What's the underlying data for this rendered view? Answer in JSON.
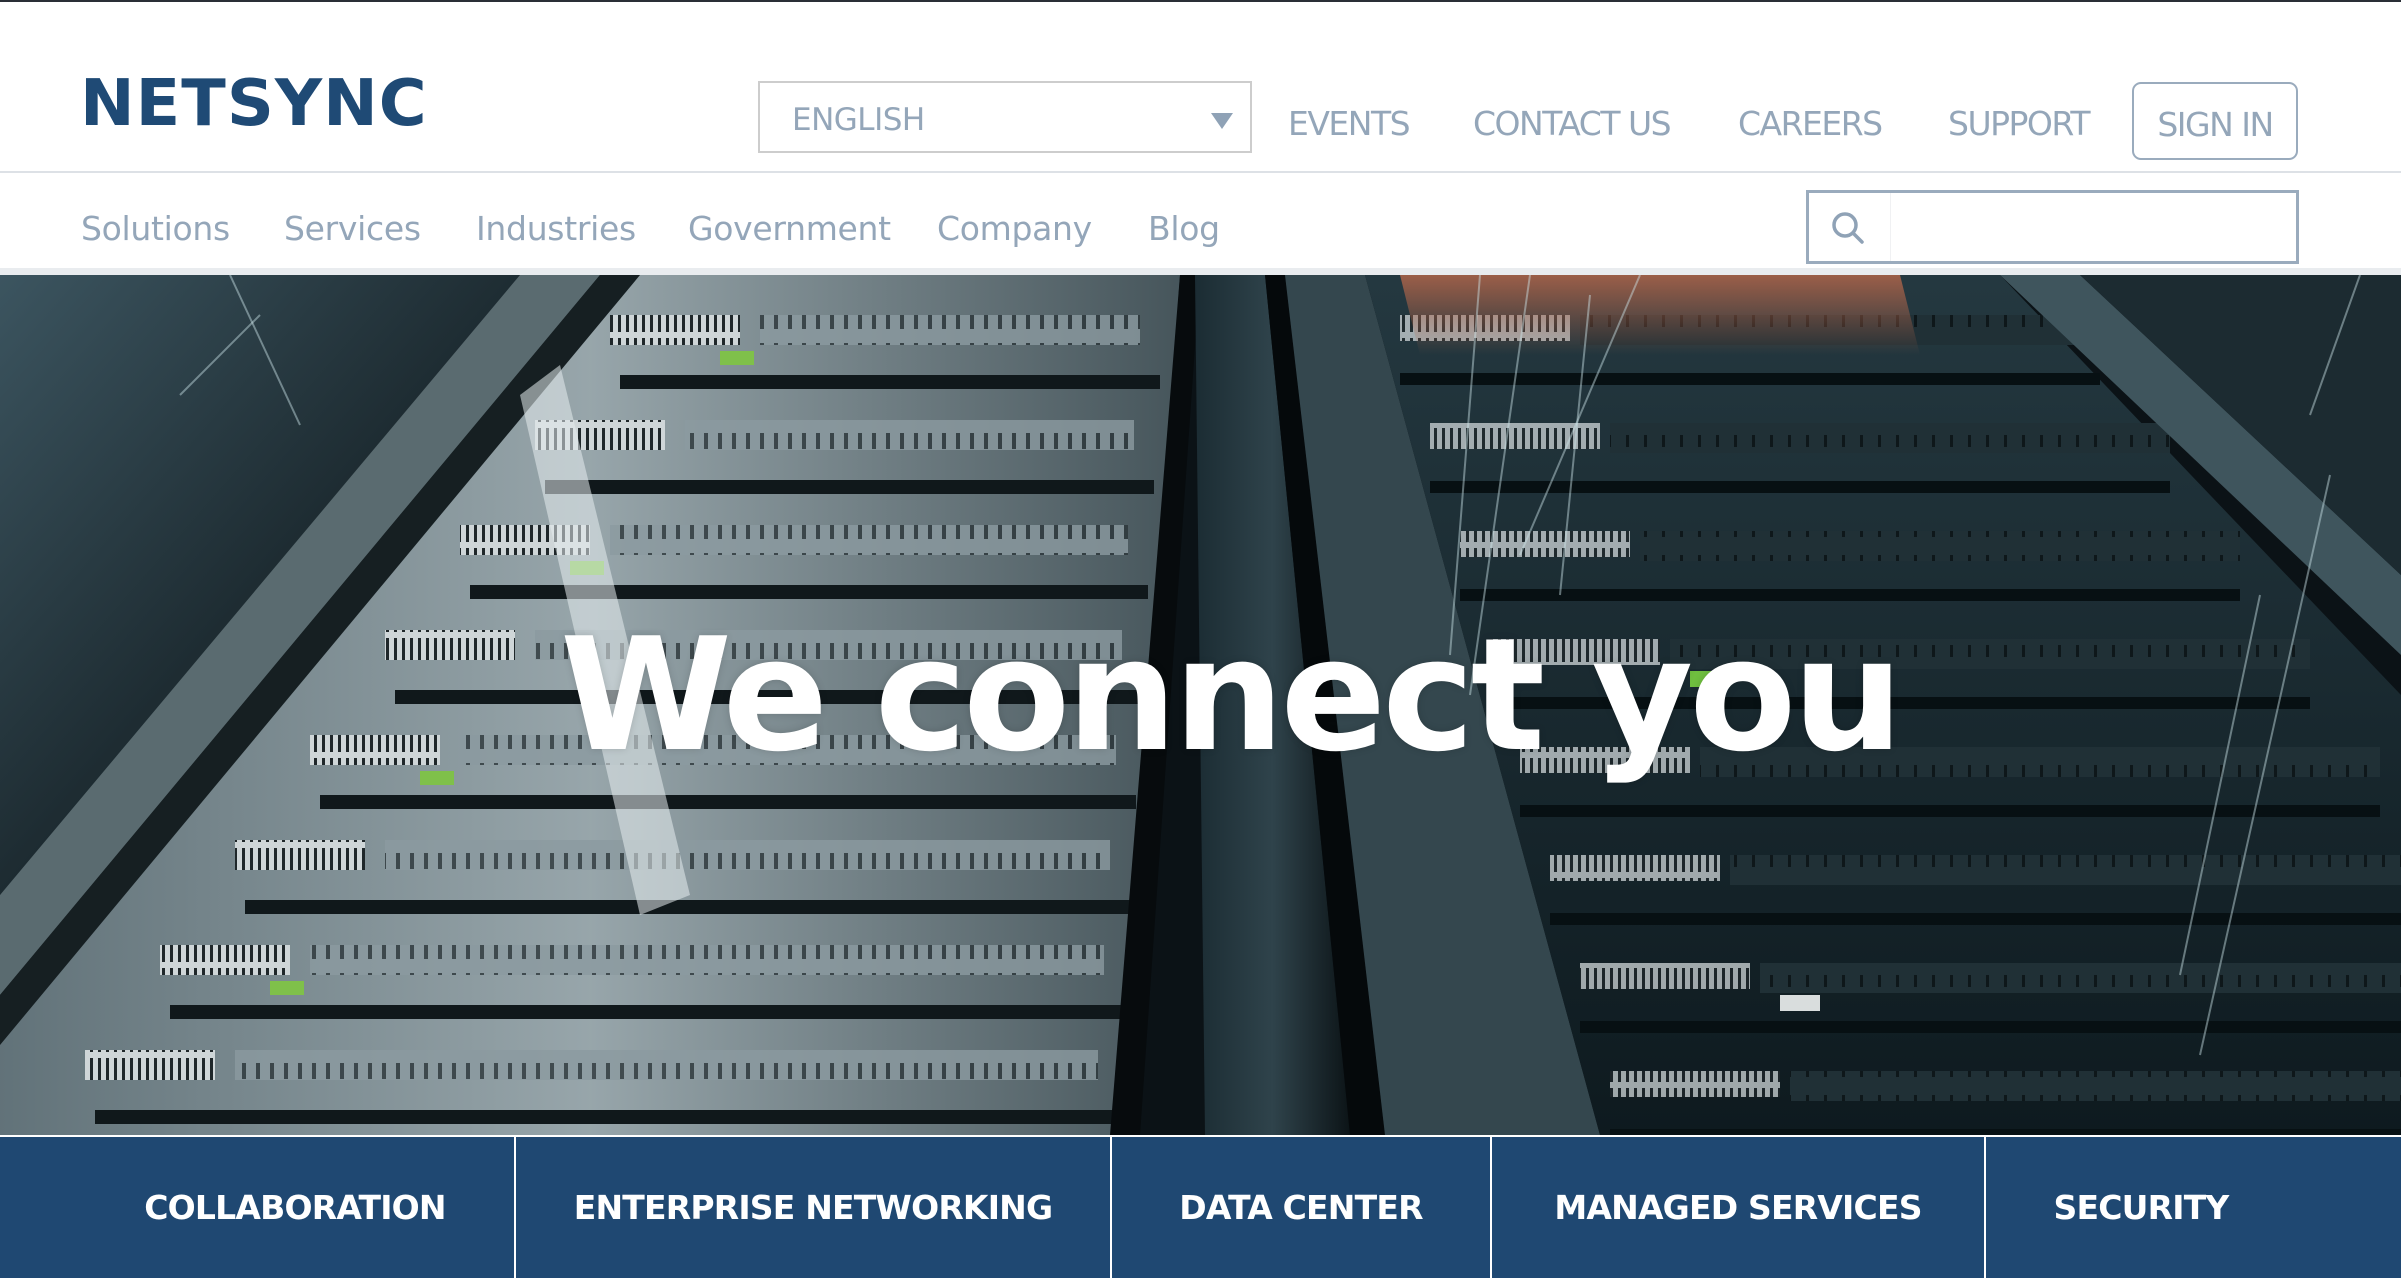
{
  "header": {
    "logo": "NETSYNC",
    "language": {
      "selected": "ENGLISH",
      "icon": "caret-down-icon"
    },
    "utility_links": [
      {
        "label": "EVENTS"
      },
      {
        "label": "CONTACT US"
      },
      {
        "label": "CAREERS"
      },
      {
        "label": "SUPPORT"
      }
    ],
    "sign_in_label": "SIGN IN",
    "main_nav": [
      {
        "label": "Solutions"
      },
      {
        "label": "Services"
      },
      {
        "label": "Industries"
      },
      {
        "label": "Government"
      },
      {
        "label": "Company"
      },
      {
        "label": "Blog"
      }
    ],
    "search": {
      "icon": "search-icon",
      "value": "",
      "placeholder": ""
    }
  },
  "hero": {
    "headline": "We connect you",
    "background": "data-center-server-racks-image"
  },
  "categories": [
    {
      "label": "COLLABORATION"
    },
    {
      "label": "ENTERPRISE NETWORKING"
    },
    {
      "label": "DATA CENTER"
    },
    {
      "label": "MANAGED SERVICES"
    },
    {
      "label": "SECURITY"
    }
  ],
  "colors": {
    "brand": "#1f4a75",
    "category_bar": "#1f4872",
    "nav_text": "#94a6b9",
    "border": "#9aabbd"
  }
}
